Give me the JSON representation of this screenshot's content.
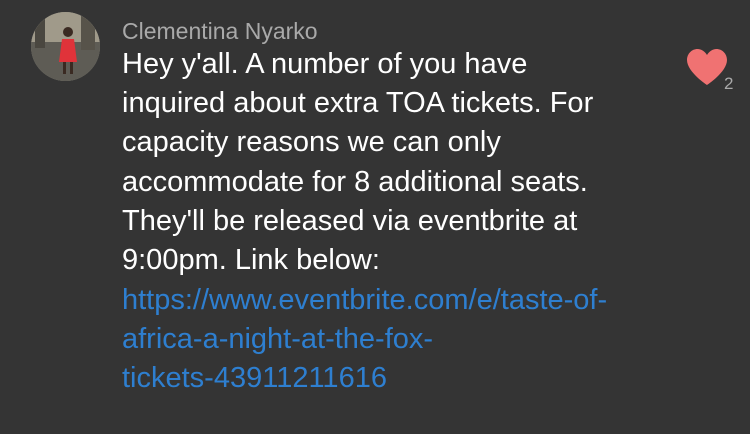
{
  "message": {
    "sender_name": "Clementina Nyarko",
    "body_lines": [
      "Hey y'all. A number of you have",
      "inquired about extra TOA tickets. For",
      "capacity reasons we can only",
      "accommodate for 8 additional seats.",
      "They'll be released via eventbrite at",
      "9:00pm. Link below:"
    ],
    "link_lines": [
      "https://www.eventbrite.com/e/taste-of-",
      "africa-a-night-at-the-fox-",
      "tickets-43911211616"
    ],
    "reaction": {
      "icon": "heart-icon",
      "count": "2",
      "color": "#f07272"
    }
  },
  "colors": {
    "background": "#343434",
    "sender": "#a9a9a9",
    "body": "#ffffff",
    "link": "#2e7fd0"
  }
}
